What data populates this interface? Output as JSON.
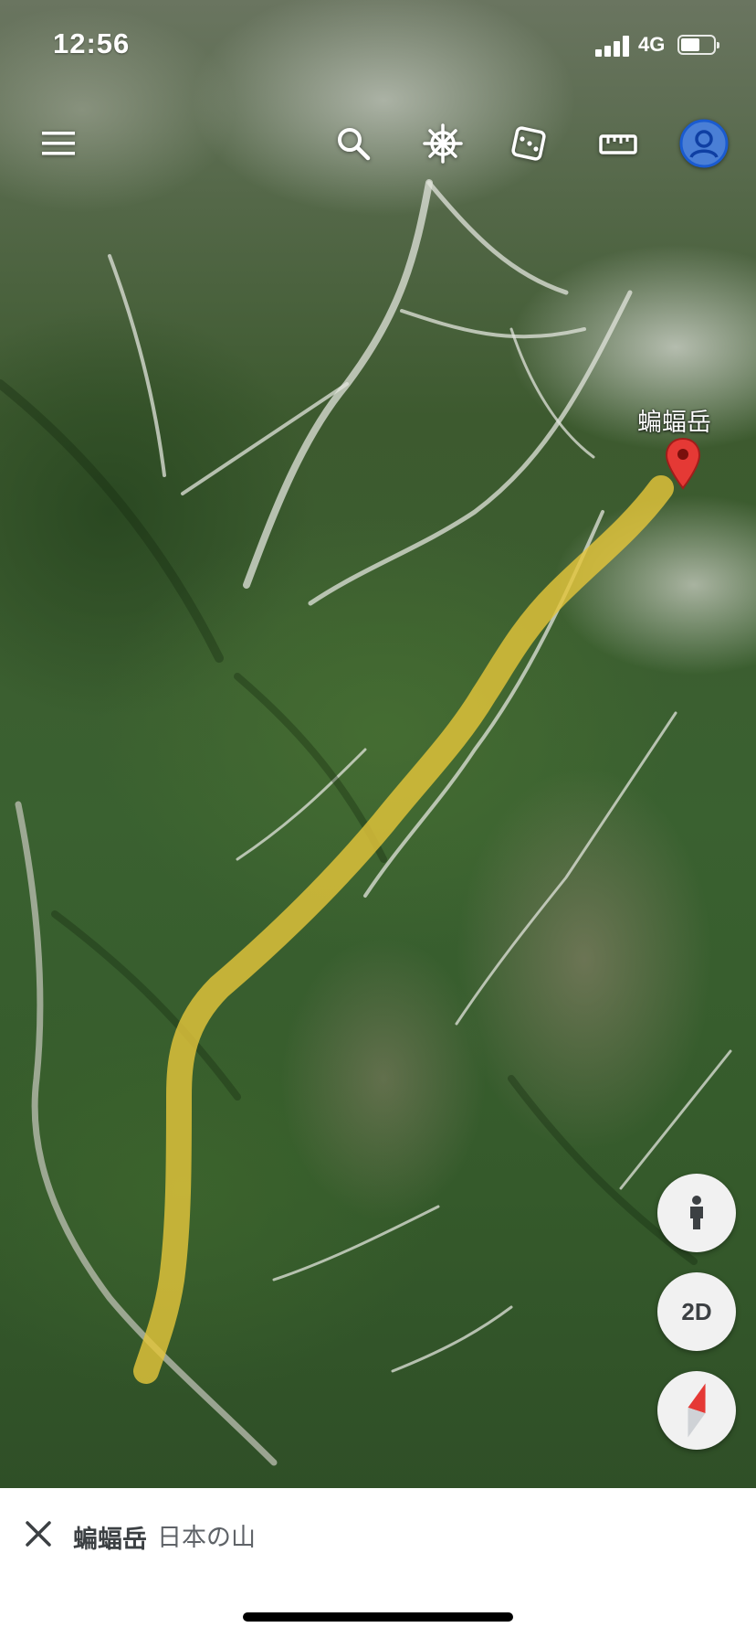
{
  "status_bar": {
    "time": "12:56",
    "network": "4G",
    "battery_level": 0.6
  },
  "toolbar": {
    "items": [
      {
        "icon": "menu-icon"
      },
      {
        "icon": "search-icon"
      },
      {
        "icon": "voyager-ship-wheel-icon"
      },
      {
        "icon": "random-dice-icon"
      },
      {
        "icon": "ruler-icon"
      },
      {
        "icon": "account-avatar-icon"
      }
    ]
  },
  "map": {
    "place_label": "蝙蝠岳",
    "route_color": "#e3c43a",
    "pin_color": "#e53935"
  },
  "controls": {
    "street_view_icon": "pegman-icon",
    "view_mode_label": "2D",
    "compass_icon": "compass-icon"
  },
  "bottom_sheet": {
    "title": "蝙蝠岳",
    "subtitle": "日本の山"
  },
  "colors": {
    "accent": "#1a73e8",
    "fab_background": "#f1f1f1",
    "sheet_background": "#ffffff"
  }
}
